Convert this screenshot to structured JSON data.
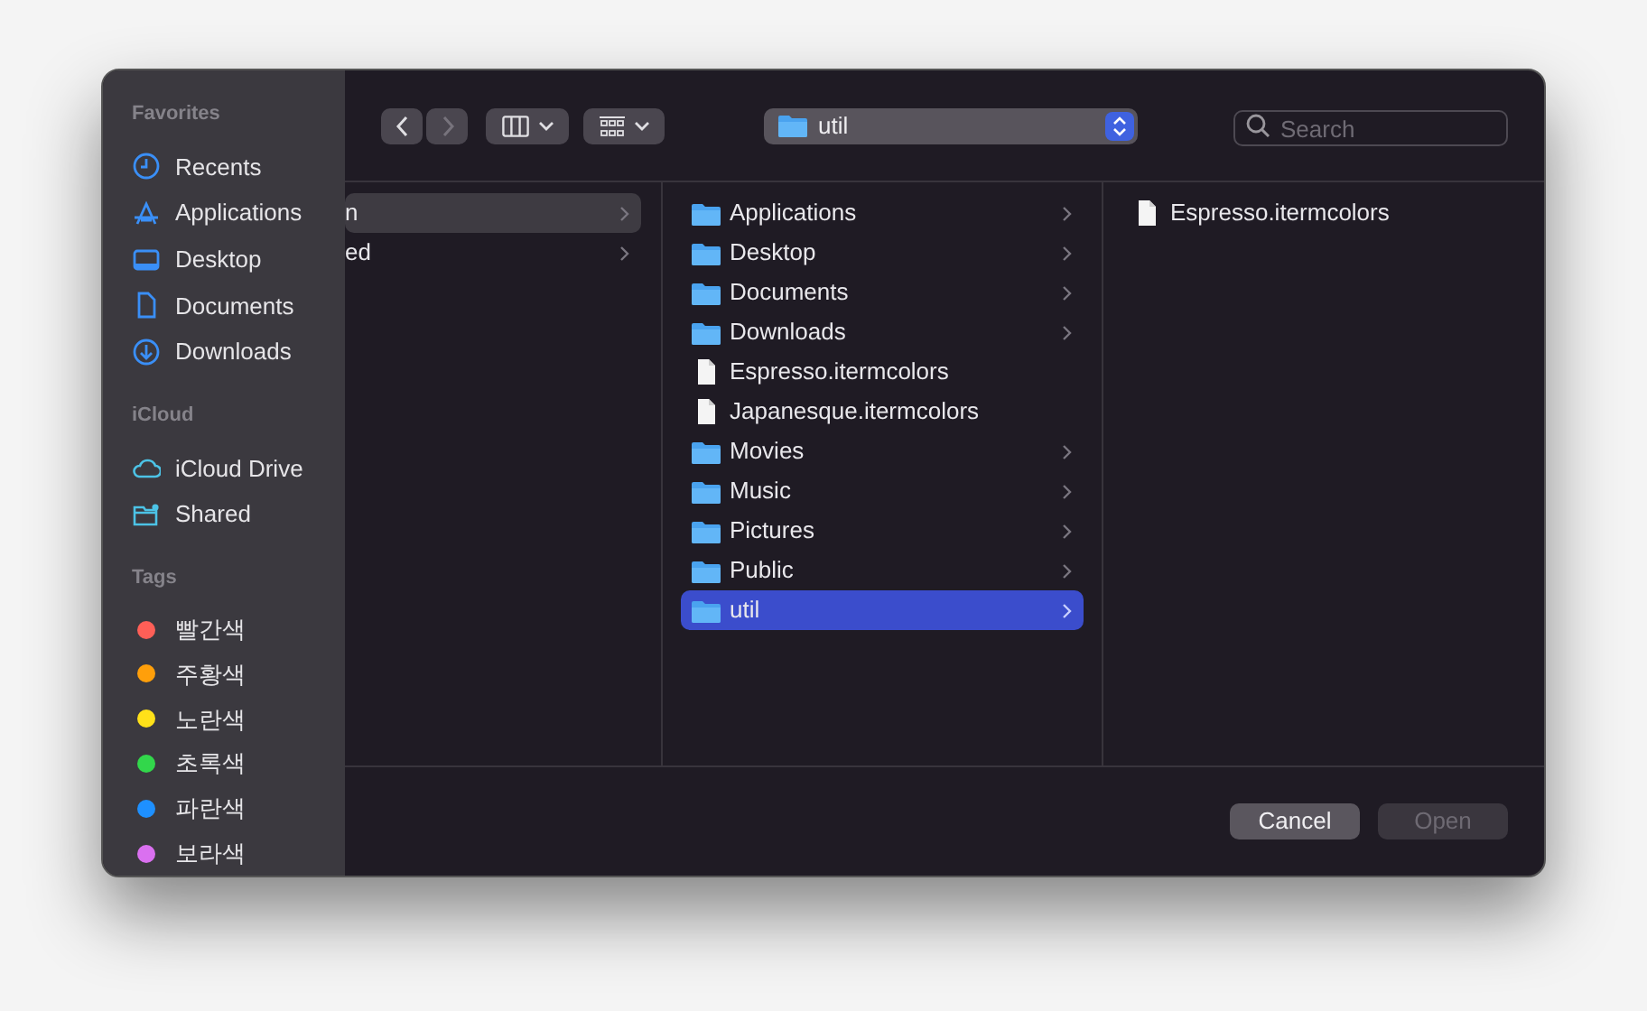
{
  "sidebar": {
    "sections": [
      {
        "title": "Favorites",
        "items": [
          {
            "label": "Recents",
            "kind": "clock"
          },
          {
            "label": "Applications",
            "kind": "apps"
          },
          {
            "label": "Desktop",
            "kind": "desktop"
          },
          {
            "label": "Documents",
            "kind": "document"
          },
          {
            "label": "Downloads",
            "kind": "download"
          }
        ]
      },
      {
        "title": "iCloud",
        "items": [
          {
            "label": "iCloud Drive",
            "kind": "cloud"
          },
          {
            "label": "Shared",
            "kind": "shared"
          }
        ]
      },
      {
        "title": "Tags",
        "items": [
          {
            "label": "빨간색",
            "kind": "tag",
            "color": "#ff5f57"
          },
          {
            "label": "주황색",
            "kind": "tag",
            "color": "#ff9f0a"
          },
          {
            "label": "노란색",
            "kind": "tag",
            "color": "#ffe119"
          },
          {
            "label": "초록색",
            "kind": "tag",
            "color": "#32d74b"
          },
          {
            "label": "파란색",
            "kind": "tag",
            "color": "#1e90ff"
          },
          {
            "label": "보라색",
            "kind": "tag",
            "color": "#da70f0"
          }
        ]
      }
    ]
  },
  "toolbar": {
    "back": {
      "disabled": false
    },
    "forward": {
      "disabled": true
    },
    "location": "util",
    "search": {
      "placeholder": "Search"
    }
  },
  "columns": [
    {
      "focused": false,
      "items": [
        {
          "name": "n",
          "kind": "folder",
          "selected": true
        },
        {
          "name": "ed",
          "kind": "folder",
          "selected": false
        }
      ]
    },
    {
      "focused": true,
      "items": [
        {
          "name": "Applications",
          "kind": "folder",
          "selected": false
        },
        {
          "name": "Desktop",
          "kind": "folder",
          "selected": false
        },
        {
          "name": "Documents",
          "kind": "folder",
          "selected": false
        },
        {
          "name": "Downloads",
          "kind": "folder",
          "selected": false
        },
        {
          "name": "Espresso.itermcolors",
          "kind": "file",
          "selected": false
        },
        {
          "name": "Japanesque.itermcolors",
          "kind": "file",
          "selected": false
        },
        {
          "name": "Movies",
          "kind": "folder",
          "selected": false
        },
        {
          "name": "Music",
          "kind": "folder",
          "selected": false
        },
        {
          "name": "Pictures",
          "kind": "folder",
          "selected": false
        },
        {
          "name": "Public",
          "kind": "folder",
          "selected": false
        },
        {
          "name": "util",
          "kind": "folder",
          "selected": true
        }
      ]
    },
    {
      "items": [
        {
          "name": "Espresso.itermcolors",
          "kind": "file",
          "selected": false
        }
      ]
    }
  ],
  "buttons": [
    {
      "label": "Cancel",
      "disabled": false
    },
    {
      "label": "Open",
      "disabled": true
    }
  ]
}
